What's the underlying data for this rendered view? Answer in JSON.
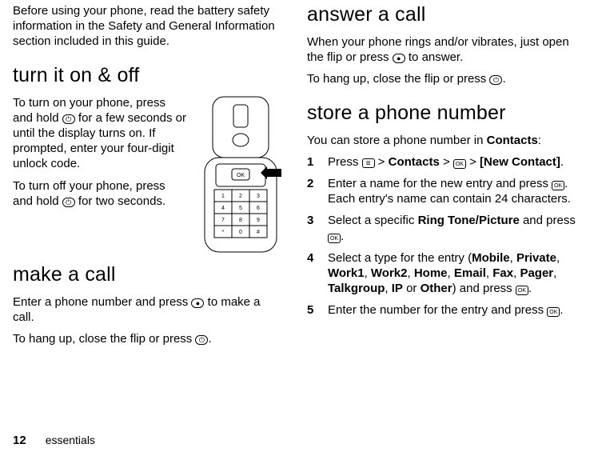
{
  "left": {
    "intro": "Before using your phone, read the battery safety information in the Safety and General Information section included in this guide.",
    "h_turn": "turn it on & off",
    "turn_on_a": "To turn on your phone, press and hold ",
    "turn_on_b": " for a few seconds or until the display turns on. If prompted, enter your four-digit unlock code.",
    "turn_off_a": "To turn off your phone, press and hold ",
    "turn_off_b": " for two seconds.",
    "h_make": "make a call",
    "make_a": "Enter a phone number and press ",
    "make_b": " to make a call.",
    "hang_a": "To hang up, close the flip or press ",
    "hang_b": "."
  },
  "right": {
    "h_answer": "answer a call",
    "ans_a": "When your phone rings and/or vibrates, just open the flip or press ",
    "ans_b": " to answer.",
    "hang_a": "To hang up, close the flip or press ",
    "hang_b": ".",
    "h_store": "store a phone number",
    "store_intro_a": "You can store a phone number in ",
    "store_intro_b": "Contacts",
    "store_intro_c": ":",
    "s1_a": "Press ",
    "s1_b": " > ",
    "s1_contacts": "Contacts",
    "s1_c": " > ",
    "s1_d": " > ",
    "s1_new": "[New Contact]",
    "s1_e": ".",
    "s2_a": "Enter a name for the new entry and press ",
    "s2_b": ". Each entry's name can contain 24 characters.",
    "s3_a": "Select a specific ",
    "s3_ring": "Ring Tone/Picture",
    "s3_b": " and press ",
    "s3_c": ".",
    "s4_a": "Select a type for the entry (",
    "s4_types": [
      "Mobile",
      "Private",
      "Work1",
      "Work2",
      "Home",
      "Email",
      "Fax",
      "Pager",
      "Talkgroup",
      "IP"
    ],
    "s4_or": " or ",
    "s4_other": "Other",
    "s4_b": ") and press ",
    "s4_c": ".",
    "s5_a": "Enter the number for the entry and press ",
    "s5_b": "."
  },
  "keys": {
    "power": "⏻",
    "send": "●",
    "end": "⏻",
    "ok": "OK",
    "menu": ""
  },
  "nums": {
    "n1": "1",
    "n2": "2",
    "n3": "3",
    "n4": "4",
    "n5": "5"
  },
  "footer": {
    "page": "12",
    "section": "essentials"
  }
}
